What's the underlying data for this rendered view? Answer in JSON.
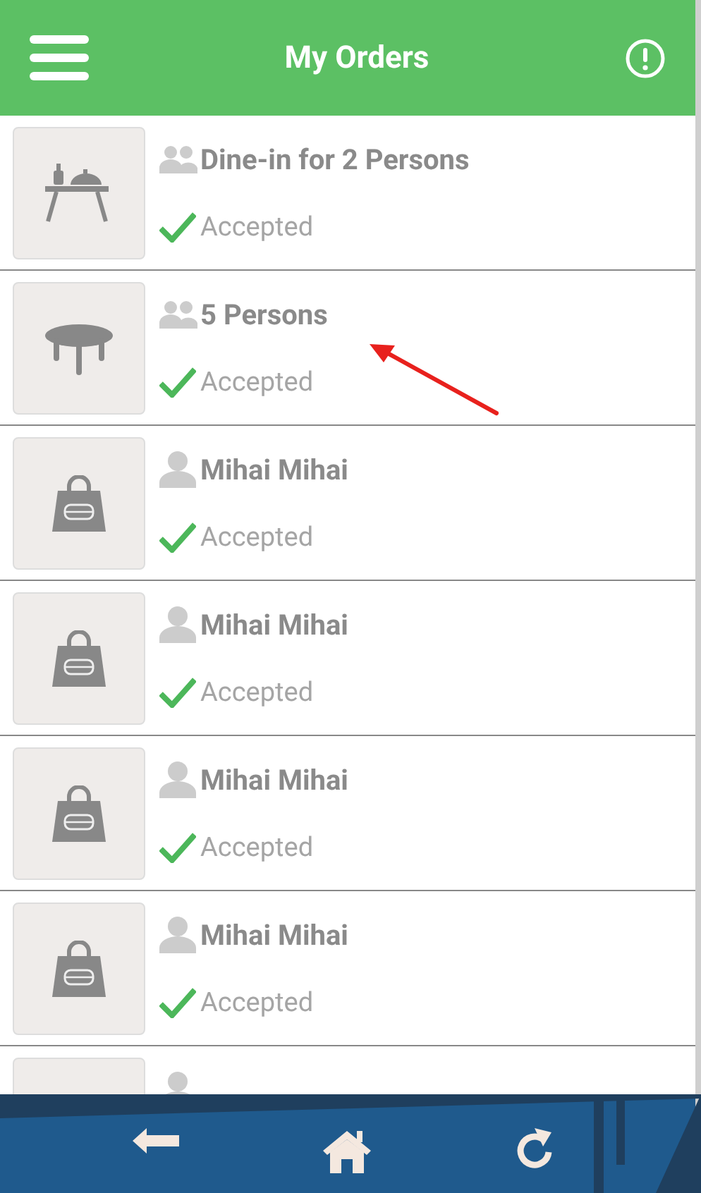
{
  "header": {
    "title": "My Orders"
  },
  "orders": [
    {
      "kind": "dine_table",
      "person": {
        "kind": "group"
      },
      "name": "Dine-in for 2 Persons",
      "status": {
        "text": "Accepted",
        "accepted": true
      }
    },
    {
      "kind": "round_table",
      "person": {
        "kind": "group"
      },
      "name": "5 Persons",
      "status": {
        "text": "Accepted",
        "accepted": true
      }
    },
    {
      "kind": "bag",
      "person": {
        "kind": "single"
      },
      "name": "Mihai Mihai",
      "status": {
        "text": "Accepted",
        "accepted": true
      }
    },
    {
      "kind": "bag",
      "person": {
        "kind": "single"
      },
      "name": "Mihai Mihai",
      "status": {
        "text": "Accepted",
        "accepted": true
      }
    },
    {
      "kind": "bag",
      "person": {
        "kind": "single"
      },
      "name": "Mihai Mihai",
      "status": {
        "text": "Accepted",
        "accepted": true
      }
    },
    {
      "kind": "bag",
      "person": {
        "kind": "single"
      },
      "name": "Mihai Mihai",
      "status": {
        "text": "Accepted",
        "accepted": true
      }
    },
    {
      "person": {
        "kind": "single"
      }
    }
  ]
}
